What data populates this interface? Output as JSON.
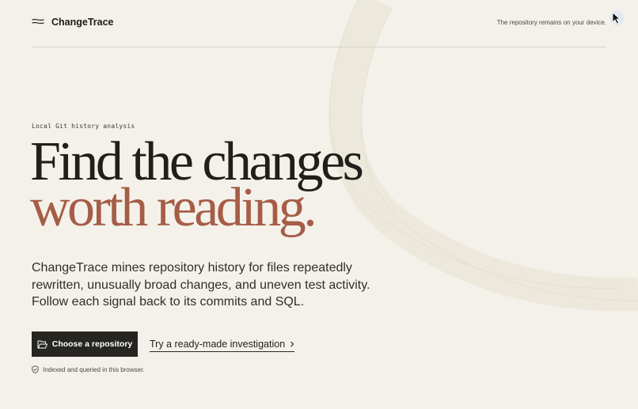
{
  "header": {
    "brand": "ChangeTrace",
    "privacy_note": "The repository remains on your device."
  },
  "hero": {
    "eyebrow": "Local Git history analysis",
    "headline_line1": "Find the changes",
    "headline_line2": "worth reading.",
    "lead": "ChangeTrace mines repository history for files repeatedly rewritten, unusually broad changes, and uneven test activity. Follow each signal back to its commits and SQL."
  },
  "actions": {
    "primary_label": "Choose a repository",
    "secondary_label": "Try a ready-made investigation"
  },
  "footnote": "Indexed and queried in this browser.",
  "colors": {
    "background": "#f4f1ea",
    "text": "#1f1f1c",
    "accent": "#a65d47",
    "button": "#262522",
    "curve": "#ece8dc"
  },
  "icons": {
    "brand": "wave-logo-icon",
    "primary": "folder-open-icon",
    "secondary": "chevron-right-icon",
    "footnote": "shield-icon",
    "cursor": "mouse-pointer-icon"
  }
}
